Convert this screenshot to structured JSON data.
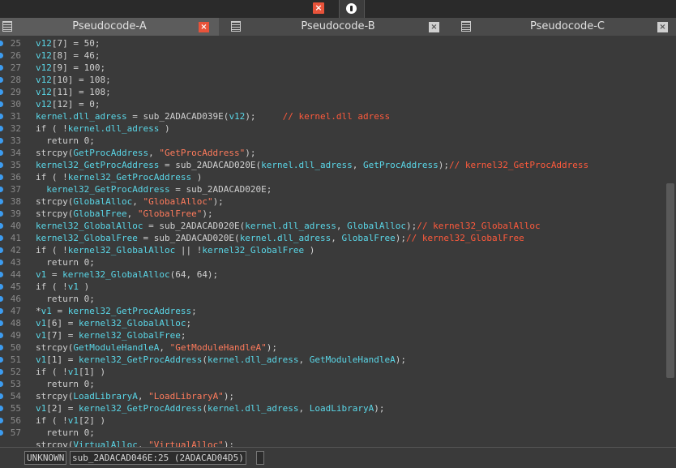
{
  "topbar": {
    "close_glyph": "×"
  },
  "tabs": [
    {
      "label": "Pseudocode-A",
      "close": "×"
    },
    {
      "label": "Pseudocode-B",
      "close": "×"
    },
    {
      "label": "Pseudocode-C",
      "close": "×"
    }
  ],
  "code_lines": [
    {
      "n": "25",
      "parts": [
        [
          "id",
          "v12"
        ],
        [
          "t",
          "[7] = 50;"
        ]
      ]
    },
    {
      "n": "26",
      "parts": [
        [
          "id",
          "v12"
        ],
        [
          "t",
          "[8] = 46;"
        ]
      ]
    },
    {
      "n": "27",
      "parts": [
        [
          "id",
          "v12"
        ],
        [
          "t",
          "[9] = 100;"
        ]
      ]
    },
    {
      "n": "28",
      "parts": [
        [
          "id",
          "v12"
        ],
        [
          "t",
          "[10] = 108;"
        ]
      ]
    },
    {
      "n": "29",
      "parts": [
        [
          "id",
          "v12"
        ],
        [
          "t",
          "[11] = 108;"
        ]
      ]
    },
    {
      "n": "30",
      "parts": [
        [
          "id",
          "v12"
        ],
        [
          "t",
          "[12] = 0;"
        ]
      ]
    },
    {
      "n": "31",
      "parts": [
        [
          "id",
          "kernel.dll_adress"
        ],
        [
          "t",
          " = sub_2ADACAD039E("
        ],
        [
          "id",
          "v12"
        ],
        [
          "t",
          ");     "
        ],
        [
          "cm",
          "// kernel.dll adress"
        ]
      ]
    },
    {
      "n": "32",
      "parts": [
        [
          "t",
          "if ( !"
        ],
        [
          "id",
          "kernel.dll_adress"
        ],
        [
          "t",
          " )"
        ]
      ]
    },
    {
      "n": "33",
      "parts": [
        [
          "t",
          "  return 0;"
        ]
      ]
    },
    {
      "n": "34",
      "parts": [
        [
          "t",
          "strcpy("
        ],
        [
          "id",
          "GetProcAddress"
        ],
        [
          "t",
          ", "
        ],
        [
          "str",
          "\"GetProcAddress\""
        ],
        [
          "t",
          ");"
        ]
      ]
    },
    {
      "n": "35",
      "parts": [
        [
          "id",
          "kernel32_GetProcAddress"
        ],
        [
          "t",
          " = sub_2ADACAD020E("
        ],
        [
          "id",
          "kernel.dll_adress"
        ],
        [
          "t",
          ", "
        ],
        [
          "id",
          "GetProcAddress"
        ],
        [
          "t",
          ");"
        ],
        [
          "cm",
          "// kernel32_GetProcAddress"
        ]
      ]
    },
    {
      "n": "36",
      "parts": [
        [
          "t",
          "if ( !"
        ],
        [
          "id",
          "kernel32_GetProcAddress"
        ],
        [
          "t",
          " )"
        ]
      ]
    },
    {
      "n": "37",
      "parts": [
        [
          "t",
          "  "
        ],
        [
          "id",
          "kernel32_GetProcAddress"
        ],
        [
          "t",
          " = sub_2ADACAD020E;"
        ]
      ]
    },
    {
      "n": "38",
      "parts": [
        [
          "t",
          "strcpy("
        ],
        [
          "id",
          "GlobalAlloc"
        ],
        [
          "t",
          ", "
        ],
        [
          "str",
          "\"GlobalAlloc\""
        ],
        [
          "t",
          ");"
        ]
      ]
    },
    {
      "n": "39",
      "parts": [
        [
          "t",
          "strcpy("
        ],
        [
          "id",
          "GlobalFree"
        ],
        [
          "t",
          ", "
        ],
        [
          "str",
          "\"GlobalFree\""
        ],
        [
          "t",
          ");"
        ]
      ]
    },
    {
      "n": "40",
      "parts": [
        [
          "id",
          "kernel32_GlobalAlloc"
        ],
        [
          "t",
          " = sub_2ADACAD020E("
        ],
        [
          "id",
          "kernel.dll_adress"
        ],
        [
          "t",
          ", "
        ],
        [
          "id",
          "GlobalAlloc"
        ],
        [
          "t",
          ");"
        ],
        [
          "cm",
          "// kernel32_GlobalAlloc"
        ]
      ]
    },
    {
      "n": "41",
      "parts": [
        [
          "id",
          "kernel32_GlobalFree"
        ],
        [
          "t",
          " = sub_2ADACAD020E("
        ],
        [
          "id",
          "kernel.dll_adress"
        ],
        [
          "t",
          ", "
        ],
        [
          "id",
          "GlobalFree"
        ],
        [
          "t",
          ");"
        ],
        [
          "cm",
          "// kernel32_GlobalFree"
        ]
      ]
    },
    {
      "n": "42",
      "parts": [
        [
          "t",
          "if ( !"
        ],
        [
          "id",
          "kernel32_GlobalAlloc"
        ],
        [
          "t",
          " || !"
        ],
        [
          "id",
          "kernel32_GlobalFree"
        ],
        [
          "t",
          " )"
        ]
      ]
    },
    {
      "n": "43",
      "parts": [
        [
          "t",
          "  return 0;"
        ]
      ]
    },
    {
      "n": "44",
      "parts": [
        [
          "id",
          "v1"
        ],
        [
          "t",
          " = "
        ],
        [
          "id",
          "kernel32_GlobalAlloc"
        ],
        [
          "t",
          "(64, 64);"
        ]
      ]
    },
    {
      "n": "45",
      "parts": [
        [
          "t",
          "if ( !"
        ],
        [
          "id",
          "v1"
        ],
        [
          "t",
          " )"
        ]
      ]
    },
    {
      "n": "46",
      "parts": [
        [
          "t",
          "  return 0;"
        ]
      ]
    },
    {
      "n": "47",
      "parts": [
        [
          "t",
          "*"
        ],
        [
          "id",
          "v1"
        ],
        [
          "t",
          " = "
        ],
        [
          "id",
          "kernel32_GetProcAddress"
        ],
        [
          "t",
          ";"
        ]
      ]
    },
    {
      "n": "48",
      "parts": [
        [
          "id",
          "v1"
        ],
        [
          "t",
          "[6] = "
        ],
        [
          "id",
          "kernel32_GlobalAlloc"
        ],
        [
          "t",
          ";"
        ]
      ]
    },
    {
      "n": "49",
      "parts": [
        [
          "id",
          "v1"
        ],
        [
          "t",
          "[7] = "
        ],
        [
          "id",
          "kernel32_GlobalFree"
        ],
        [
          "t",
          ";"
        ]
      ]
    },
    {
      "n": "50",
      "parts": [
        [
          "t",
          "strcpy("
        ],
        [
          "id",
          "GetModuleHandleA"
        ],
        [
          "t",
          ", "
        ],
        [
          "str",
          "\"GetModuleHandleA\""
        ],
        [
          "t",
          ");"
        ]
      ]
    },
    {
      "n": "51",
      "parts": [
        [
          "id",
          "v1"
        ],
        [
          "t",
          "[1] = "
        ],
        [
          "id",
          "kernel32_GetProcAddress"
        ],
        [
          "t",
          "("
        ],
        [
          "id",
          "kernel.dll_adress"
        ],
        [
          "t",
          ", "
        ],
        [
          "id",
          "GetModuleHandleA"
        ],
        [
          "t",
          ");"
        ]
      ]
    },
    {
      "n": "52",
      "parts": [
        [
          "t",
          "if ( !"
        ],
        [
          "id",
          "v1"
        ],
        [
          "t",
          "[1] )"
        ]
      ]
    },
    {
      "n": "53",
      "parts": [
        [
          "t",
          "  return 0;"
        ]
      ]
    },
    {
      "n": "54",
      "parts": [
        [
          "t",
          "strcpy("
        ],
        [
          "id",
          "LoadLibraryA"
        ],
        [
          "t",
          ", "
        ],
        [
          "str",
          "\"LoadLibraryA\""
        ],
        [
          "t",
          ");"
        ]
      ]
    },
    {
      "n": "55",
      "parts": [
        [
          "id",
          "v1"
        ],
        [
          "t",
          "[2] = "
        ],
        [
          "id",
          "kernel32_GetProcAddress"
        ],
        [
          "t",
          "("
        ],
        [
          "id",
          "kernel.dll_adress"
        ],
        [
          "t",
          ", "
        ],
        [
          "id",
          "LoadLibraryA"
        ],
        [
          "t",
          ");"
        ]
      ]
    },
    {
      "n": "56",
      "parts": [
        [
          "t",
          "if ( !"
        ],
        [
          "id",
          "v1"
        ],
        [
          "t",
          "[2] )"
        ]
      ]
    },
    {
      "n": "57",
      "parts": [
        [
          "t",
          "  return 0;"
        ]
      ]
    },
    {
      "n": "",
      "parts": [
        [
          "t",
          "strcpy("
        ],
        [
          "id",
          "VirtualAlloc"
        ],
        [
          "t",
          ", "
        ],
        [
          "str",
          "\"VirtualAlloc\""
        ],
        [
          "t",
          ");"
        ]
      ]
    }
  ],
  "status": {
    "segment": "UNKNOWN",
    "location": "sub_2ADACAD046E:25 (2ADACAD04D5)"
  },
  "colors": {
    "identifier": "#5ad7e8",
    "string": "#ff7b5c",
    "comment": "#ff5a3c",
    "text": "#d0d0d0",
    "close_button": "#e8533a"
  }
}
